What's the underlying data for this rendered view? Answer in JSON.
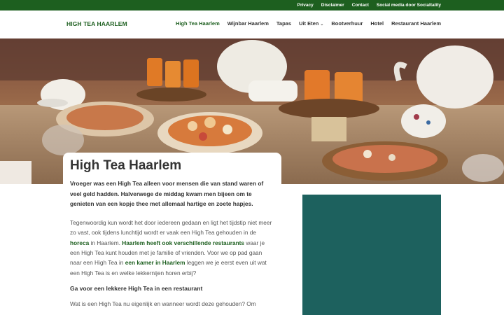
{
  "topbar": {
    "links": [
      "Privacy",
      "Disclaimer",
      "Contact",
      "Social media door Socialtality"
    ]
  },
  "header": {
    "logo": "HIGH TEA HAARLEM",
    "nav": [
      "High Tea Haarlem",
      "Wijnbar Haarlem",
      "Tapas",
      "Uit Eten",
      "Bootverhuur",
      "Hotel",
      "Restaurant Haarlem"
    ],
    "nav_dropdown_icon": "chevron-down-icon"
  },
  "article": {
    "title": "High Tea Haarlem",
    "intro": "Vroeger was een High Tea alleen voor mensen die van stand waren of veel geld hadden. Halverwege de middag kwam men bijeen om te genieten van een kopje thee met allemaal hartige en zoete hapjes.",
    "p1": {
      "t1": "Tegenwoordig kun wordt het door iedereen gedaan en ligt het tijdstip niet meer zo vast, ook tijdens lunchtijd wordt er vaak een High Tea gehouden in de ",
      "link1": "horeca",
      "t2": " in Haarlem. ",
      "link2": "Haarlem heeft ook verschillende restaurants",
      "t3": " waar je een High Tea kunt houden met je familie of vrienden. Voor we op pad gaan naar een High Tea in ",
      "link3": "een kamer in Haarlem",
      "t4": " leggen we je eerst even uit wat een High Tea is en welke lekkernijen horen erbij?"
    },
    "subheading": "Ga voor een lekkere High Tea in een restaurant",
    "p2": "Wat is een High Tea nu eigenlijk en wanneer wordt deze gehouden? Om"
  },
  "colors": {
    "brand_green": "#1d5f1f",
    "sidebar_teal": "#1d615e"
  }
}
